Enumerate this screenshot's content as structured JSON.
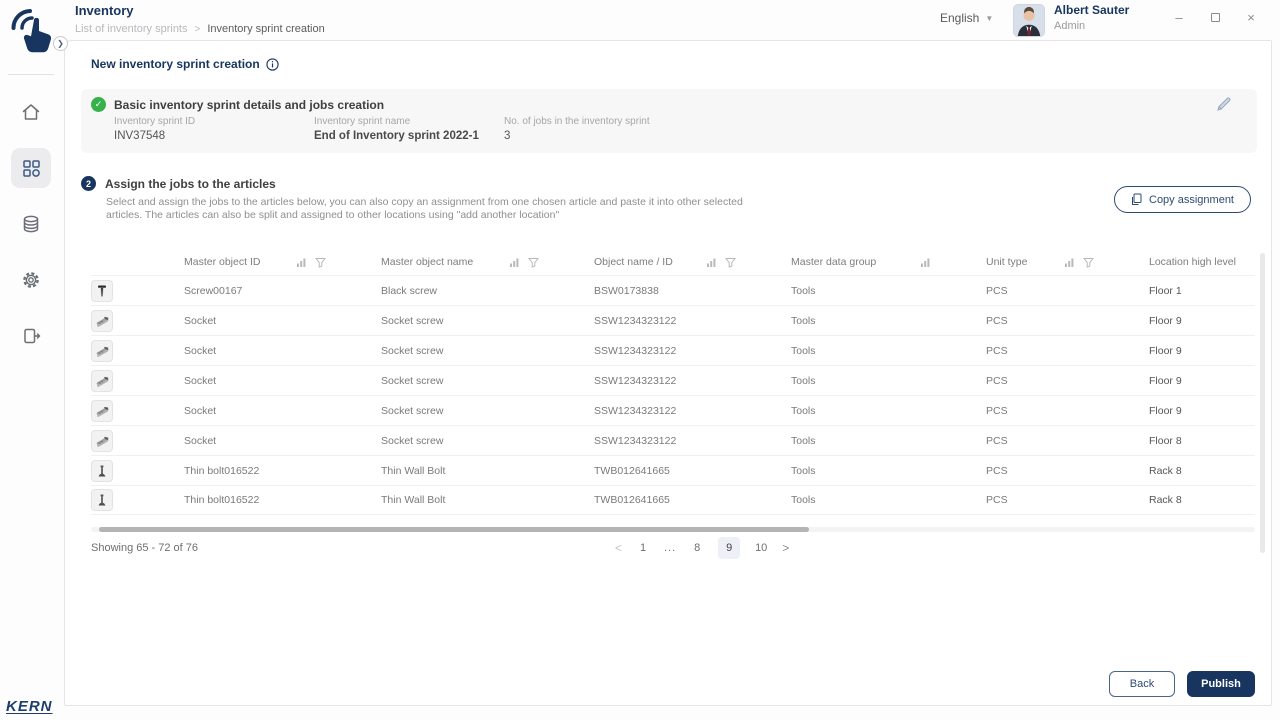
{
  "colors": {
    "navy": "#17355f",
    "green": "#36b24a",
    "card_bg": "#f7f7f7",
    "active_nav_bg": "#ececee"
  },
  "sidebar": {
    "brand": "KERN",
    "items": [
      {
        "key": "home",
        "icon": "home-icon",
        "active": false
      },
      {
        "key": "inventory-modules",
        "icon": "dashboard-grid-icon",
        "active": true
      },
      {
        "key": "database",
        "icon": "database-icon",
        "active": false
      },
      {
        "key": "settings",
        "icon": "gear-icon",
        "active": false
      },
      {
        "key": "logout",
        "icon": "logout-icon",
        "active": false
      }
    ]
  },
  "header": {
    "title": "Inventory",
    "breadcrumb": {
      "parent": "List of inventory sprints",
      "separator": ">",
      "current": "Inventory sprint creation"
    },
    "language": "English",
    "user": {
      "name": "Albert Sauter",
      "role": "Admin"
    },
    "window_controls": [
      "minimize",
      "maximize",
      "close"
    ]
  },
  "page": {
    "title": "New inventory sprint creation",
    "step1": {
      "title": "Basic inventory sprint details and jobs creation",
      "fields": [
        {
          "label": "Inventory sprint ID",
          "value": "INV37548"
        },
        {
          "label": "Inventory sprint name",
          "value": "End of Inventory sprint 2022-1"
        },
        {
          "label": "No. of jobs in the inventory sprint",
          "value": "3"
        }
      ]
    },
    "step2": {
      "number": "2",
      "title": "Assign the jobs to the articles",
      "description": "Select and assign the jobs to the articles below, you can also copy an assignment from one chosen article and paste it into other selected articles. The articles can also be split and assigned to other locations using \"add another location\"",
      "copy_button": "Copy assignment"
    },
    "table": {
      "columns": [
        {
          "label": "",
          "sort": false,
          "filter": false
        },
        {
          "label": "Master object ID",
          "sort": true,
          "filter": true
        },
        {
          "label": "Master object name",
          "sort": true,
          "filter": true
        },
        {
          "label": "Object name / ID",
          "sort": true,
          "filter": true
        },
        {
          "label": "Master data group",
          "sort": true,
          "filter": false
        },
        {
          "label": "Unit type",
          "sort": true,
          "filter": true
        },
        {
          "label": "Location high level",
          "sort": false,
          "filter": false
        }
      ],
      "rows": [
        {
          "icon": "screw-thumbnail",
          "master_id": "Screw00167",
          "master_name": "Black screw",
          "object_id": "BSW0173838",
          "group": "Tools",
          "unit": "PCS",
          "location": "Floor 1"
        },
        {
          "icon": "socket-thumbnail",
          "master_id": "Socket",
          "master_name": "Socket screw",
          "object_id": "SSW1234323122",
          "group": "Tools",
          "unit": "PCS",
          "location": "Floor 9"
        },
        {
          "icon": "socket-thumbnail",
          "master_id": "Socket",
          "master_name": "Socket screw",
          "object_id": "SSW1234323122",
          "group": "Tools",
          "unit": "PCS",
          "location": "Floor 9"
        },
        {
          "icon": "socket-thumbnail",
          "master_id": "Socket",
          "master_name": "Socket screw",
          "object_id": "SSW1234323122",
          "group": "Tools",
          "unit": "PCS",
          "location": "Floor 9"
        },
        {
          "icon": "socket-thumbnail",
          "master_id": "Socket",
          "master_name": "Socket screw",
          "object_id": "SSW1234323122",
          "group": "Tools",
          "unit": "PCS",
          "location": "Floor 9"
        },
        {
          "icon": "socket-thumbnail",
          "master_id": "Socket",
          "master_name": "Socket screw",
          "object_id": "SSW1234323122",
          "group": "Tools",
          "unit": "PCS",
          "location": "Floor 8"
        },
        {
          "icon": "bolt-thumbnail",
          "master_id": "Thin bolt016522",
          "master_name": "Thin Wall Bolt",
          "object_id": "TWB012641665",
          "group": "Tools",
          "unit": "PCS",
          "location": "Rack 8"
        },
        {
          "icon": "bolt-thumbnail",
          "master_id": "Thin bolt016522",
          "master_name": "Thin Wall Bolt",
          "object_id": "TWB012641665",
          "group": "Tools",
          "unit": "PCS",
          "location": "Rack 8"
        }
      ]
    },
    "pagination": {
      "showing": "Showing 65 - 72 of 76",
      "prev": "<",
      "next": ">",
      "pages": [
        "1",
        "...",
        "8",
        "9",
        "10"
      ],
      "active_page": "9"
    },
    "actions": {
      "back": "Back",
      "publish": "Publish"
    }
  }
}
